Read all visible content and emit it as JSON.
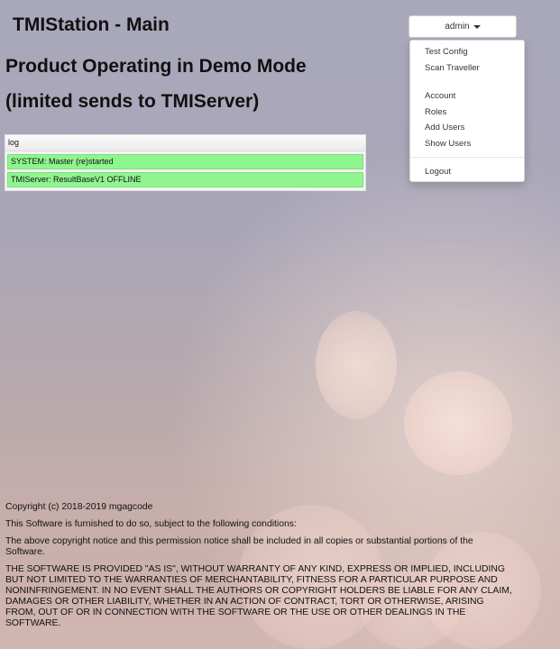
{
  "header": {
    "title": "TMIStation - Main"
  },
  "status": {
    "line1": "Product Operating in Demo Mode",
    "line2": "(limited sends to TMIServer)"
  },
  "log": {
    "header": "log",
    "entries": [
      "SYSTEM: Master (re)started",
      "TMIServer: ResultBaseV1 OFFLINE"
    ],
    "entry_color": "#8ff58f"
  },
  "user_menu": {
    "toggle_label": "admin",
    "items": [
      "Test Config",
      "Scan Traveller",
      "Account",
      "Roles",
      "Add Users",
      "Show Users",
      "Logout"
    ]
  },
  "footer": {
    "copyright": "Copyright (c) 2018-2019 mgagcode",
    "p1": "This Software is furnished to do so, subject to the following conditions:",
    "p2": "The above copyright notice and this permission notice shall be included in all copies or substantial portions of the Software.",
    "p3": "THE SOFTWARE IS PROVIDED \"AS IS\", WITHOUT WARRANTY OF ANY KIND, EXPRESS OR IMPLIED, INCLUDING BUT NOT LIMITED TO THE WARRANTIES OF MERCHANTABILITY, FITNESS FOR A PARTICULAR PURPOSE AND NONINFRINGEMENT. IN NO EVENT SHALL THE AUTHORS OR COPYRIGHT HOLDERS BE LIABLE FOR ANY CLAIM, DAMAGES OR OTHER LIABILITY, WHETHER IN AN ACTION OF CONTRACT, TORT OR OTHERWISE, ARISING FROM, OUT OF OR IN CONNECTION WITH THE SOFTWARE OR THE USE OR OTHER DEALINGS IN THE SOFTWARE."
  }
}
